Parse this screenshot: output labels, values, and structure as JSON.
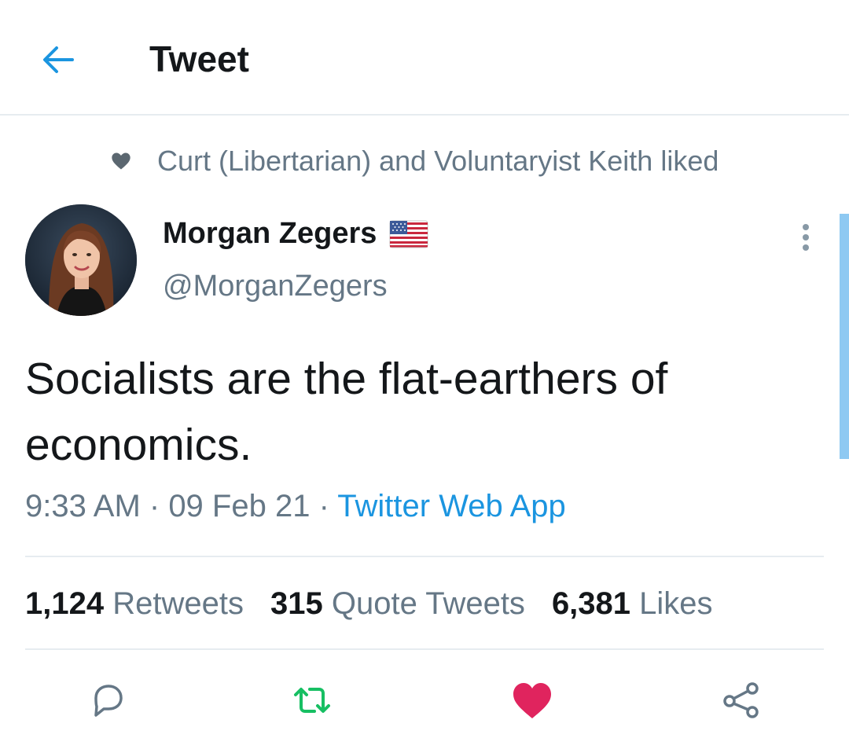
{
  "header": {
    "back_icon": "arrow-left-icon",
    "title": "Tweet"
  },
  "social_context": {
    "icon": "heart-icon",
    "text": "Curt (Libertarian) and Voluntaryist Keith liked"
  },
  "author": {
    "name": "Morgan Zegers",
    "handle": "@MorganZegers",
    "name_emoji": "us-flag-icon"
  },
  "tweet": {
    "text": "Socialists are the flat-earthers of economics.",
    "time": "9:33 AM",
    "date": "09 Feb 21",
    "separator": " · ",
    "source": "Twitter Web App"
  },
  "stats": {
    "retweets_count": "1,124",
    "retweets_label": "Retweets",
    "quotes_count": "315",
    "quotes_label": "Quote Tweets",
    "likes_count": "6,381",
    "likes_label": "Likes"
  },
  "actions": {
    "reply_icon": "reply-icon",
    "retweet_icon": "retweet-icon",
    "like_icon": "heart-icon",
    "share_icon": "share-icon"
  },
  "colors": {
    "accent": "#1b95e0",
    "retweet_green": "#17bf63",
    "like_red": "#e0245e",
    "secondary_text": "#657786"
  }
}
